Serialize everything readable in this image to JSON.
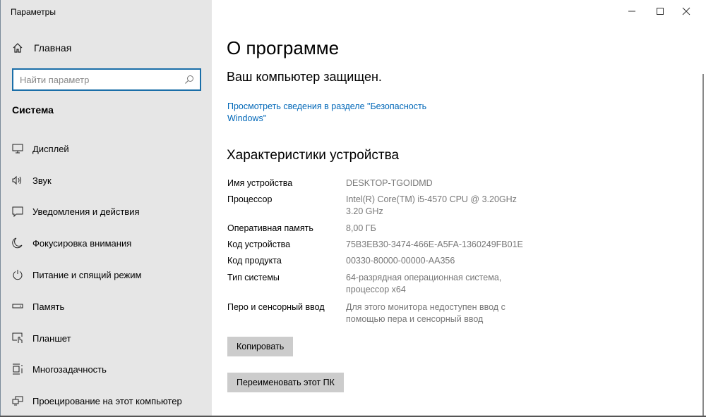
{
  "app_title": "Параметры",
  "sidebar": {
    "home_label": "Главная",
    "search_placeholder": "Найти параметр",
    "section_title": "Система",
    "items": [
      {
        "label": "Дисплей",
        "icon": "display-icon"
      },
      {
        "label": "Звук",
        "icon": "sound-icon"
      },
      {
        "label": "Уведомления и действия",
        "icon": "notification-icon"
      },
      {
        "label": "Фокусировка внимания",
        "icon": "moon-icon"
      },
      {
        "label": "Питание и спящий режим",
        "icon": "power-icon"
      },
      {
        "label": "Память",
        "icon": "storage-icon"
      },
      {
        "label": "Планшет",
        "icon": "tablet-icon"
      },
      {
        "label": "Многозадачность",
        "icon": "multitasking-icon"
      },
      {
        "label": "Проецирование на этот компьютер",
        "icon": "projecting-icon"
      }
    ]
  },
  "main": {
    "title": "О программе",
    "protected_text": "Ваш компьютер защищен.",
    "security_link": "Просмотреть сведения в разделе \"Безопасность Windows\"",
    "specs_heading": "Характеристики устройства",
    "specs": [
      {
        "label": "Имя устройства",
        "value": "DESKTOP-TGOIDMD"
      },
      {
        "label": "Процессор",
        "value": "Intel(R) Core(TM) i5-4570 CPU @ 3.20GHz   3.20 GHz"
      },
      {
        "label": "Оперативная память",
        "value": "8,00 ГБ"
      },
      {
        "label": "Код устройства",
        "value": "75B3EB30-3474-466E-A5FA-1360249FB01E"
      },
      {
        "label": "Код продукта",
        "value": "00330-80000-00000-AA356"
      },
      {
        "label": "Тип системы",
        "value": "64-разрядная операционная система, процессор x64"
      },
      {
        "label": "Перо и сенсорный ввод",
        "value": "Для этого монитора недоступен ввод с помощью пера и сенсорный ввод"
      }
    ],
    "copy_button": "Копировать",
    "rename_button": "Переименовать этот ПК"
  },
  "colors": {
    "link": "#0067b8",
    "sidebar_bg": "#e6e6e6",
    "button_bg": "#cccccc"
  }
}
